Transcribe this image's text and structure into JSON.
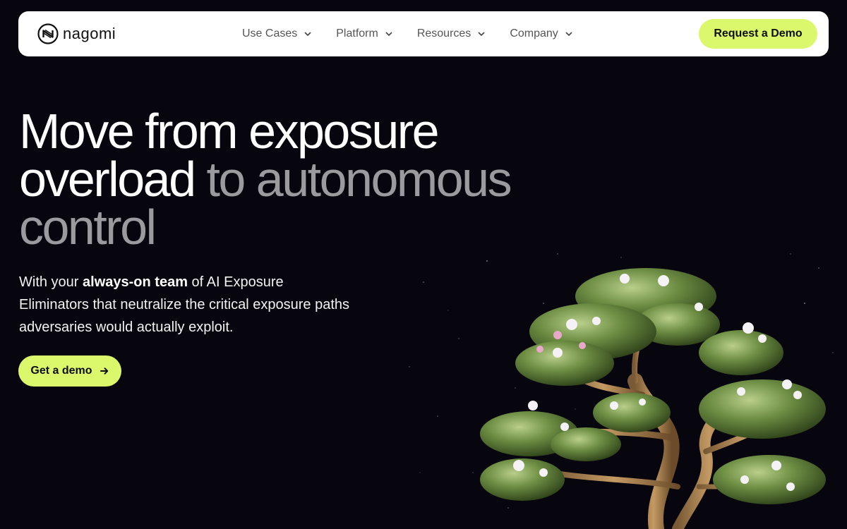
{
  "brand": {
    "name": "nagomi",
    "logo_icon": "nagomi-logo-icon"
  },
  "nav": {
    "items": [
      {
        "label": "Use Cases",
        "icon": "chevron-down-icon"
      },
      {
        "label": "Platform",
        "icon": "chevron-down-icon"
      },
      {
        "label": "Resources",
        "icon": "chevron-down-icon"
      },
      {
        "label": "Company",
        "icon": "chevron-down-icon"
      }
    ],
    "cta_label": "Request a Demo"
  },
  "hero": {
    "headline_white_1": "Move from exposure",
    "headline_white_2": "overload",
    "headline_gray_1": "to autonomous",
    "headline_gray_2": "control",
    "sub_pre": "With your ",
    "sub_bold": "always-on team",
    "sub_post": " of AI Exposure Eliminators that neutralize the critical exposure paths adversaries would actually exploit.",
    "cta_label": "Get a demo",
    "cta_icon": "arrow-right-icon",
    "illustration": "bonsai-tree-illustration"
  },
  "colors": {
    "background": "#07060e",
    "accent": "#dbf76b",
    "headline_gray": "#9a9a9f",
    "nav_bg": "#ffffff"
  }
}
